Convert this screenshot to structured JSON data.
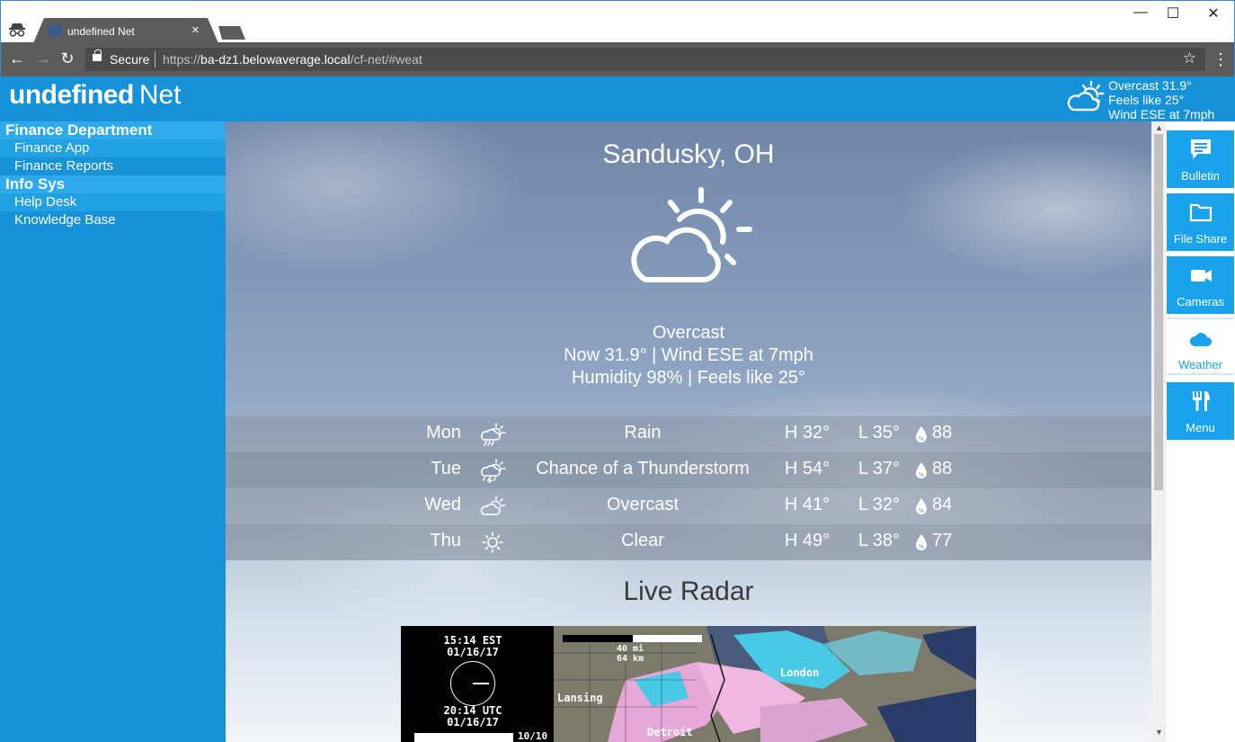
{
  "browser": {
    "tab_title": "undefined Net",
    "tab_close": "×",
    "window_controls": {
      "minimize": "—",
      "maximize": "☐",
      "close": "✕"
    },
    "nav": {
      "back": "←",
      "forward": "→",
      "reload": "↻"
    },
    "secure_label": "Secure",
    "url_scheme": "https://",
    "url_host": "ba-dz1.belowaverage.local",
    "url_path": "/cf-net/#weat",
    "star": "☆",
    "menu": "⋮",
    "incognito_icon": "incognito-icon"
  },
  "header": {
    "brand_bold": "undefined",
    "brand_light": "Net",
    "weather_summary": [
      "Overcast 31.9°",
      "Feels like 25°",
      "Wind ESE at 7mph"
    ],
    "weather_icon": "partly-cloudy-icon",
    "bg_color": "#1592d8"
  },
  "sidebar": {
    "sections": [
      {
        "title": "Finance Department",
        "links": [
          "Finance App",
          "Finance Reports"
        ]
      },
      {
        "title": "Info Sys",
        "links": [
          "Help Desk",
          "Knowledge Base"
        ]
      }
    ]
  },
  "weather": {
    "city": "Sandusky, OH",
    "condition": "Overcast",
    "now_line": "Now 31.9° | Wind ESE at 7mph",
    "humidity_line": "Humidity 98% | Feels like 25°",
    "main_icon": "partly-cloudy-icon",
    "forecast": [
      {
        "day": "Mon",
        "icon": "rain-icon",
        "condition": "Rain",
        "high": "H 32°",
        "low": "L 35°",
        "precip": "88"
      },
      {
        "day": "Tue",
        "icon": "thunderstorm-icon",
        "condition": "Chance of a Thunderstorm",
        "high": "H 54°",
        "low": "L 37°",
        "precip": "88"
      },
      {
        "day": "Wed",
        "icon": "partly-cloudy-icon",
        "condition": "Overcast",
        "high": "H 41°",
        "low": "L 32°",
        "precip": "84"
      },
      {
        "day": "Thu",
        "icon": "sun-icon",
        "condition": "Clear",
        "high": "H 49°",
        "low": "L 38°",
        "precip": "77"
      }
    ]
  },
  "radar": {
    "title": "Live Radar",
    "time_local": "15:14 EST",
    "date_local": "01/16/17",
    "time_utc": "20:14 UTC",
    "date_utc": "01/16/17",
    "frame": "10/10",
    "scale_mi": "40 mi",
    "scale_km": "64 km",
    "cities": [
      "Lansing",
      "London",
      "Detroit"
    ]
  },
  "rightrail": {
    "tiles": [
      {
        "label": "Bulletin",
        "icon": "chat-icon",
        "active": false
      },
      {
        "label": "File Share",
        "icon": "folder-icon",
        "active": false
      },
      {
        "label": "Cameras",
        "icon": "video-camera-icon",
        "active": false
      },
      {
        "label": "Weather",
        "icon": "cloud-icon",
        "active": true
      },
      {
        "label": "Menu",
        "icon": "fork-knife-icon",
        "active": false
      }
    ],
    "accent": "#1aa3ed"
  },
  "scrollbar": {
    "up": "▲",
    "down": "▼"
  }
}
